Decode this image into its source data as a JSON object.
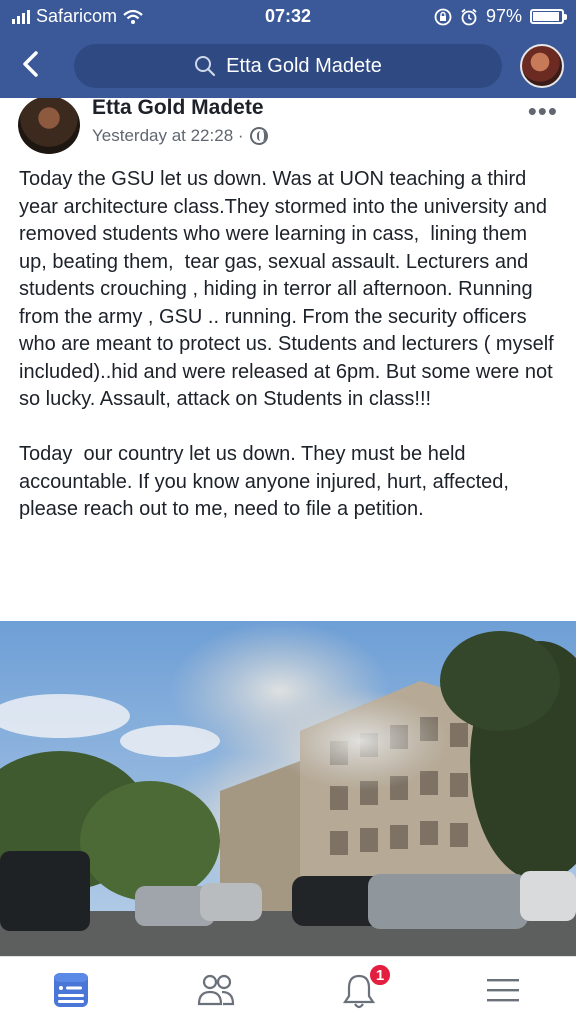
{
  "status_bar": {
    "carrier": "Safaricom",
    "time": "07:32",
    "battery": "97%"
  },
  "search": {
    "query": "Etta Gold Madete"
  },
  "post": {
    "author": "Etta Gold Madete",
    "timestamp": "Yesterday at 22:28 ·",
    "more_label": "•••",
    "text": "Today the GSU let us down. Was at UON teaching a third year architecture class.They stormed into the university and removed students who were learning in cass,  lining them up, beating them,  tear gas, sexual assault. Lecturers and students crouching , hiding in terror all afternoon. Running from the army , GSU .. running. From the security officers who are meant to protect us. Students and lecturers ( myself included)..hid and were released at 6pm. But some were not so lucky. Assault, attack on Students in class!!!\n\nToday  our country let us down. They must be held accountable. If you know anyone injured, hurt, affected, please reach out to me, need to file a petition."
  },
  "nav": {
    "notifications_badge": "1",
    "icons": [
      "news-feed-icon",
      "friends-icon",
      "notifications-icon",
      "menu-icon"
    ]
  },
  "colors": {
    "brand": "#3b5998",
    "accent": "#4a76d8",
    "badge": "#e41e3f"
  }
}
